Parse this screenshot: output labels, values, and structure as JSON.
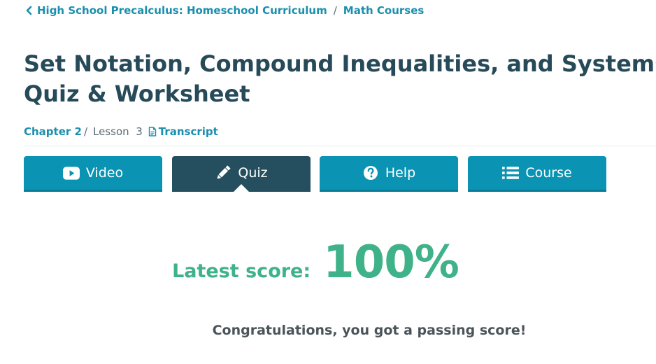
{
  "breadcrumb": {
    "course_label": "High School Precalculus: Homeschool Curriculum",
    "separator": "/",
    "category_label": "Math Courses"
  },
  "page": {
    "title_line1": "Set Notation, Compound Inequalities, and Systems of Inequalities",
    "title_line2": "Quiz & Worksheet"
  },
  "meta": {
    "chapter_label": "Chapter 2",
    "separator": "/",
    "lesson_label": "Lesson  3",
    "transcript_label": "Transcript"
  },
  "tabs": [
    {
      "label": "Video",
      "icon": "play-icon",
      "active": false
    },
    {
      "label": "Quiz",
      "icon": "pencil-icon",
      "active": true
    },
    {
      "label": "Help",
      "icon": "question-circle-icon",
      "active": false
    },
    {
      "label": "Course",
      "icon": "list-icon",
      "active": false
    }
  ],
  "score": {
    "label": "Latest score:",
    "value": "100%"
  },
  "message": "Congratulations, you got a passing score!",
  "colors": {
    "link": "#1a8fae",
    "tab": "#0a93b3",
    "tab_active": "#254f5f",
    "success": "#3fb28a",
    "title": "#274a59"
  }
}
